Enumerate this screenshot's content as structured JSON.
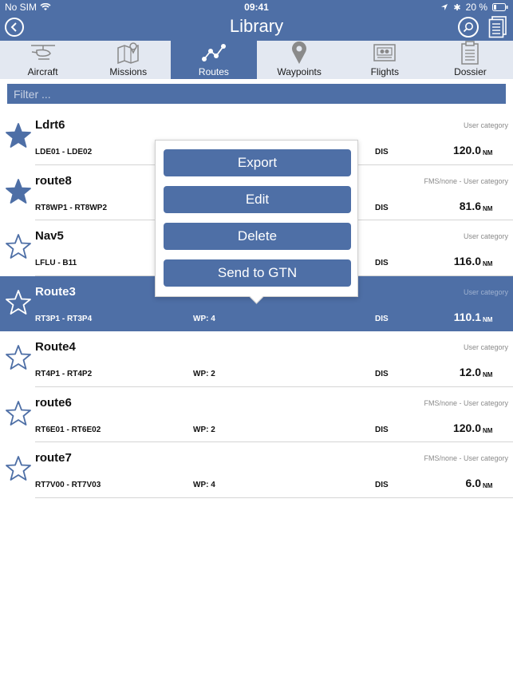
{
  "status": {
    "carrier": "No SIM",
    "time": "09:41",
    "battery": "20 %"
  },
  "nav": {
    "title": "Library"
  },
  "tabs": [
    {
      "label": "Aircraft",
      "icon": "helicopter-icon",
      "active": false
    },
    {
      "label": "Missions",
      "icon": "map-icon",
      "active": false
    },
    {
      "label": "Routes",
      "icon": "route-icon",
      "active": true
    },
    {
      "label": "Waypoints",
      "icon": "pin-icon",
      "active": false
    },
    {
      "label": "Flights",
      "icon": "flight-recorder-icon",
      "active": false
    },
    {
      "label": "Dossier",
      "icon": "clipboard-icon",
      "active": false
    }
  ],
  "filter": {
    "placeholder": "Filter ..."
  },
  "routes": [
    {
      "name": "Ldrt6",
      "category": "User category",
      "range": "LDE01 - LDE02",
      "wp": "",
      "dis": "DIS",
      "distance": "120.0",
      "unit": "NM",
      "favorite": true
    },
    {
      "name": "route8",
      "category": "FMS/none - User category",
      "range": "RT8WP1 - RT8WP2",
      "wp": "",
      "dis": "DIS",
      "distance": "81.6",
      "unit": "NM",
      "favorite": true
    },
    {
      "name": "Nav5",
      "category": "User category",
      "range": "LFLU - B11",
      "wp": "",
      "dis": "DIS",
      "distance": "116.0",
      "unit": "NM",
      "favorite": false
    },
    {
      "name": "Route3",
      "category": "User category",
      "range": "RT3P1 - RT3P4",
      "wp": "WP: 4",
      "dis": "DIS",
      "distance": "110.1",
      "unit": "NM",
      "favorite": false
    },
    {
      "name": "Route4",
      "category": "User category",
      "range": "RT4P1 - RT4P2",
      "wp": "WP: 2",
      "dis": "DIS",
      "distance": "12.0",
      "unit": "NM",
      "favorite": false
    },
    {
      "name": "route6",
      "category": "FMS/none - User category",
      "range": "RT6E01 - RT6E02",
      "wp": "WP: 2",
      "dis": "DIS",
      "distance": "120.0",
      "unit": "NM",
      "favorite": false
    },
    {
      "name": "route7",
      "category": "FMS/none - User category",
      "range": "RT7V00 - RT7V03",
      "wp": "WP: 4",
      "dis": "DIS",
      "distance": "6.0",
      "unit": "NM",
      "favorite": false
    }
  ],
  "selected_index": 3,
  "popover": {
    "export": "Export",
    "edit": "Edit",
    "delete": "Delete",
    "send": "Send to GTN"
  },
  "colors": {
    "accent": "#4e6fa6",
    "tabbar": "#e3e8f1"
  }
}
